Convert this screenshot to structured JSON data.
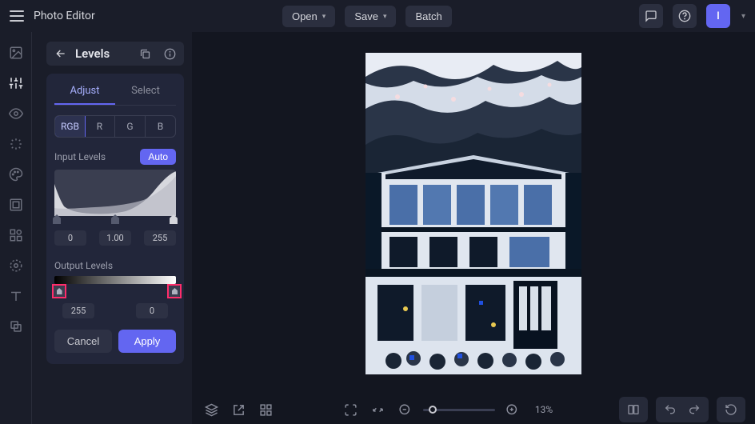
{
  "app": {
    "title": "Photo Editor"
  },
  "topbar": {
    "open": "Open",
    "save": "Save",
    "batch": "Batch",
    "avatar_initial": "I"
  },
  "panel": {
    "title": "Levels",
    "tabs": {
      "adjust": "Adjust",
      "select": "Select"
    },
    "channels": {
      "rgb": "RGB",
      "r": "R",
      "g": "G",
      "b": "B"
    },
    "input_label": "Input Levels",
    "auto": "Auto",
    "input_values": {
      "black": "0",
      "mid": "1.00",
      "white": "255"
    },
    "output_label": "Output Levels",
    "output_values": {
      "left": "255",
      "right": "0"
    },
    "cancel": "Cancel",
    "apply": "Apply"
  },
  "zoom": {
    "percent": "13%"
  },
  "colors": {
    "accent": "#6366f1",
    "highlight": "#ff2d6b"
  }
}
